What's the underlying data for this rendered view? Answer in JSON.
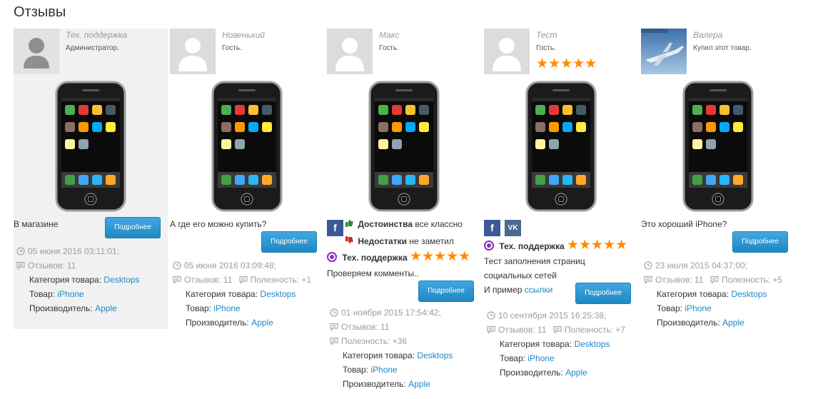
{
  "page": {
    "title": "Отзывы"
  },
  "icons": {
    "clock": "clock-icon",
    "comment": "comment-icon",
    "like": "thumbs-up-icon",
    "dislike": "thumbs-down-icon",
    "support": "support-badge-icon"
  },
  "colors": {
    "link": "#1e87c7",
    "button": "#2b9ad6",
    "stars": "#ff8a00",
    "muted": "#9c9c9c"
  },
  "labels": {
    "details_button": "Подробнее",
    "category": "Категория товара:",
    "product": "Товар:",
    "manufacturer": "Производитель:",
    "category_value": "Desktops",
    "product_value": "iPhone",
    "manufacturer_value": "Apple",
    "advantages": "Достоинства",
    "disadvantages": "Недостатки",
    "support": "Тех. поддержка"
  },
  "reviews": [
    {
      "author": "Тех. поддержка",
      "role": "Администратор.",
      "text": "В магазине",
      "date": "05 июня 2016 03:11:01;",
      "reviews_count": "Отзывов: 11"
    },
    {
      "author": "Новенький",
      "role": "Гость.",
      "text": "А где его можно купить?",
      "date": "05 июня 2016 03:09:48;",
      "reviews_count": "Отзывов: 11",
      "usefulness": "Полезность: +1"
    },
    {
      "author": "Макс",
      "role": "Гость.",
      "advantages_text": "все классно",
      "disadvantages_text": "не заметил",
      "support_rating": 5,
      "text": "Проверяем комменты..",
      "date": "01 ноября 2015 17:54:42;",
      "reviews_count": "Отзывов: 11",
      "usefulness": "Полезность: +36"
    },
    {
      "author": "Тест",
      "role": "Гость.",
      "rating": 5,
      "support_rating": 5,
      "text_line1": "Тест заполнения страниц",
      "text_line2": "социальных сетей",
      "text_line3_prefix": "И пример",
      "text_link": "ссылки",
      "date": "10 сентября 2015 16:25:38;",
      "reviews_count": "Отзывов: 11",
      "usefulness": "Полезность: +7"
    },
    {
      "author": "Валера",
      "role": "Купил этот товар.",
      "text": "Это хороший  iPhone?",
      "date": "23 июля 2015 04:37:00;",
      "reviews_count": "Отзывов: 11",
      "usefulness": "Полезность: +5"
    }
  ]
}
